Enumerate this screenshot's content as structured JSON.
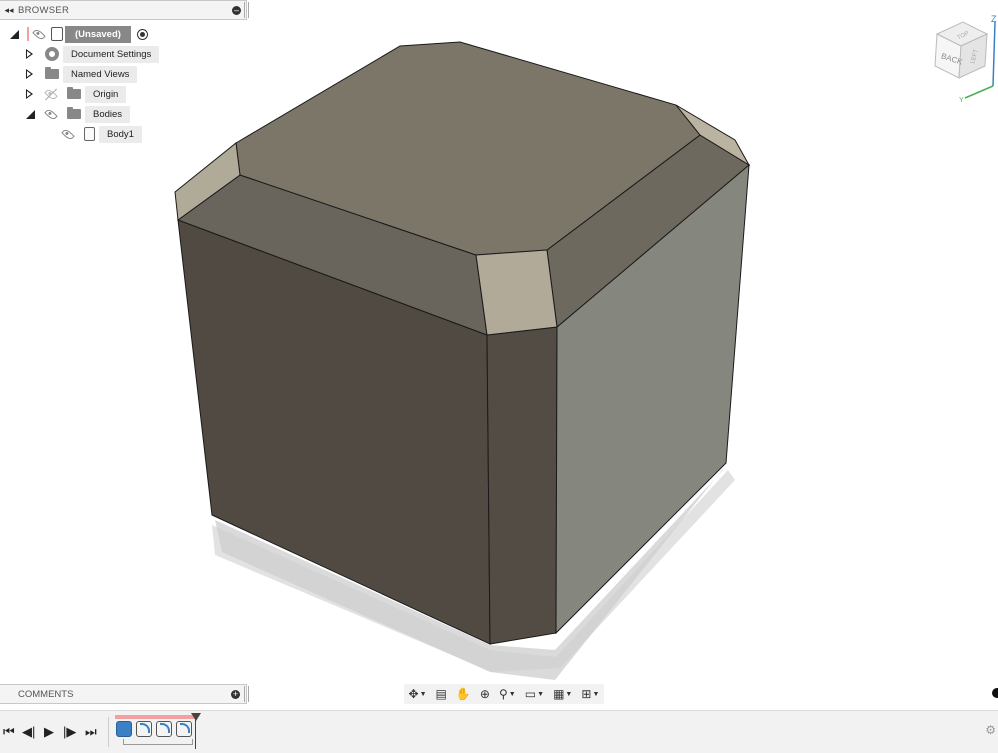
{
  "browser": {
    "title": "BROWSER",
    "collapse_glyph": "◂◂",
    "root": {
      "label": "(Unsaved)"
    },
    "items": [
      {
        "label": "Document Settings",
        "icon": "gear-icon",
        "expanded": false,
        "visible": null
      },
      {
        "label": "Named Views",
        "icon": "folder-icon",
        "expanded": false,
        "visible": null
      },
      {
        "label": "Origin",
        "icon": "folder-icon",
        "expanded": false,
        "visible": false
      },
      {
        "label": "Bodies",
        "icon": "folder-icon",
        "expanded": true,
        "visible": true
      },
      {
        "label": "Body1",
        "icon": "body-icon",
        "expanded": null,
        "visible": true
      }
    ]
  },
  "viewcube": {
    "face_label": "BACK",
    "top_label": "TOP",
    "side_label": "LEFT",
    "axis_z": "Z",
    "axis_y": "Y"
  },
  "comments": {
    "title": "COMMENTS"
  },
  "nav_toolbar": {
    "tools": [
      "orbit-icon",
      "look-at-icon",
      "pan-icon",
      "zoom-icon",
      "fit-icon",
      "display-settings-icon",
      "grid-settings-icon",
      "viewports-icon"
    ]
  },
  "timeline": {
    "controls": [
      "skip-to-start",
      "step-back",
      "play",
      "step-forward",
      "skip-to-end"
    ],
    "features": [
      "extrude",
      "fillet",
      "fillet",
      "fillet"
    ]
  },
  "colors": {
    "model_dark": "#504a43",
    "model_mid": "#6a655c",
    "model_top": "#7b7668",
    "model_light_face": "#85877f",
    "fillet_highlight": "#b1aa98",
    "accent_blue": "#3b7fc4",
    "timeline_red": "#f4a0a0"
  }
}
